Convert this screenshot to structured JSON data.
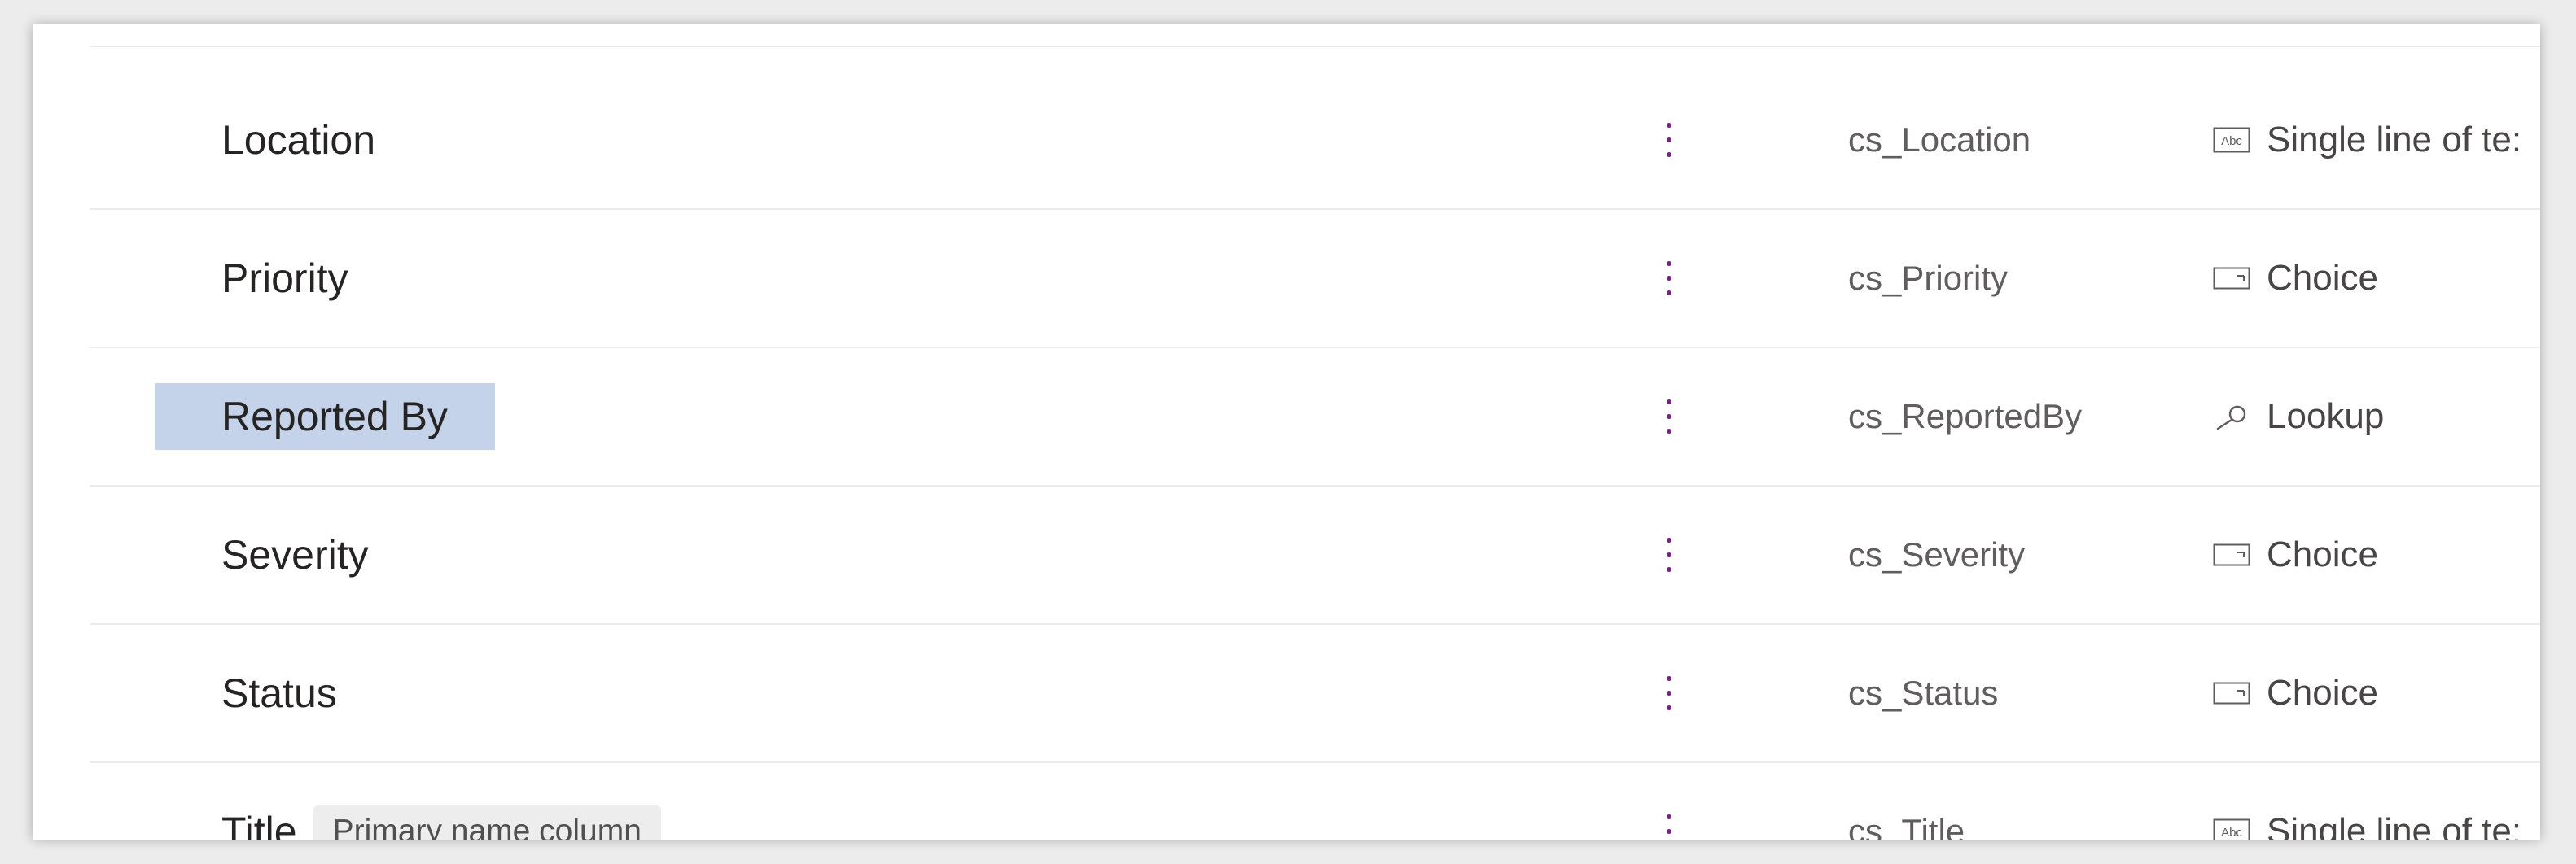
{
  "rows": [
    {
      "display_name": "Location",
      "badge": "",
      "schema_name": "cs_Location",
      "data_type": "Single line of te:",
      "type_icon": "single-line-text-icon",
      "selected": false
    },
    {
      "display_name": "Priority",
      "badge": "",
      "schema_name": "cs_Priority",
      "data_type": "Choice",
      "type_icon": "choice-icon",
      "selected": false
    },
    {
      "display_name": "Reported By",
      "badge": "",
      "schema_name": "cs_ReportedBy",
      "data_type": "Lookup",
      "type_icon": "lookup-icon",
      "selected": true
    },
    {
      "display_name": "Severity",
      "badge": "",
      "schema_name": "cs_Severity",
      "data_type": "Choice",
      "type_icon": "choice-icon",
      "selected": false
    },
    {
      "display_name": "Status",
      "badge": "",
      "schema_name": "cs_Status",
      "data_type": "Choice",
      "type_icon": "choice-icon",
      "selected": false
    },
    {
      "display_name": "Title",
      "badge": "Primary name column",
      "schema_name": "cs_Title",
      "data_type": "Single line of te:",
      "type_icon": "single-line-text-icon",
      "selected": false
    }
  ],
  "colors": {
    "selection": "#c4d3ea",
    "more_dots": "#7a1f86",
    "divider": "#ebebeb"
  }
}
